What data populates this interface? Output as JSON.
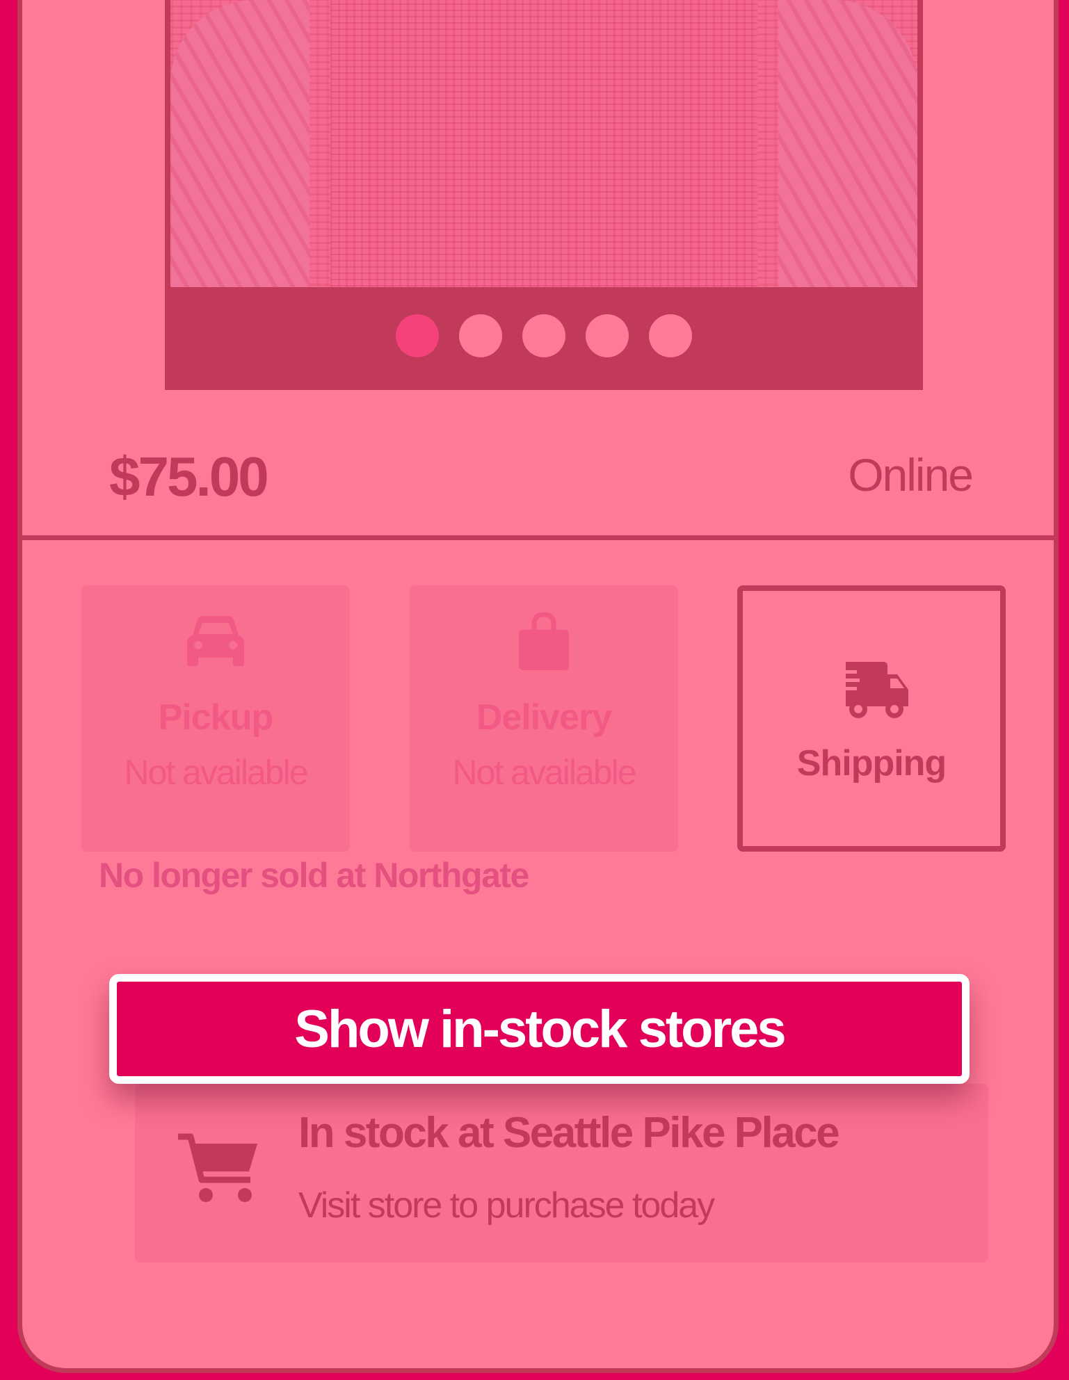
{
  "product": {
    "price": "$75.00",
    "channel": "Online",
    "carousel": {
      "slide_count": 5,
      "active_index": 0
    }
  },
  "fulfillment": {
    "pickup": {
      "title": "Pickup",
      "status": "Not available",
      "icon": "car-icon"
    },
    "delivery": {
      "title": "Delivery",
      "status": "Not available",
      "icon": "shopping-bag-icon"
    },
    "shipping": {
      "title": "Shipping",
      "icon": "shipping-truck-icon"
    }
  },
  "availability_notice": "No longer sold at Northgate",
  "cta": {
    "label": "Show in-stock stores"
  },
  "store_card": {
    "title": "In stock at Seattle Pike Place",
    "subtitle": "Visit store to purchase today",
    "icon": "cart-icon"
  },
  "colors": {
    "brand": "#e30058",
    "card_bg": "#ff7a97",
    "accent_dark": "#c23a5a"
  }
}
